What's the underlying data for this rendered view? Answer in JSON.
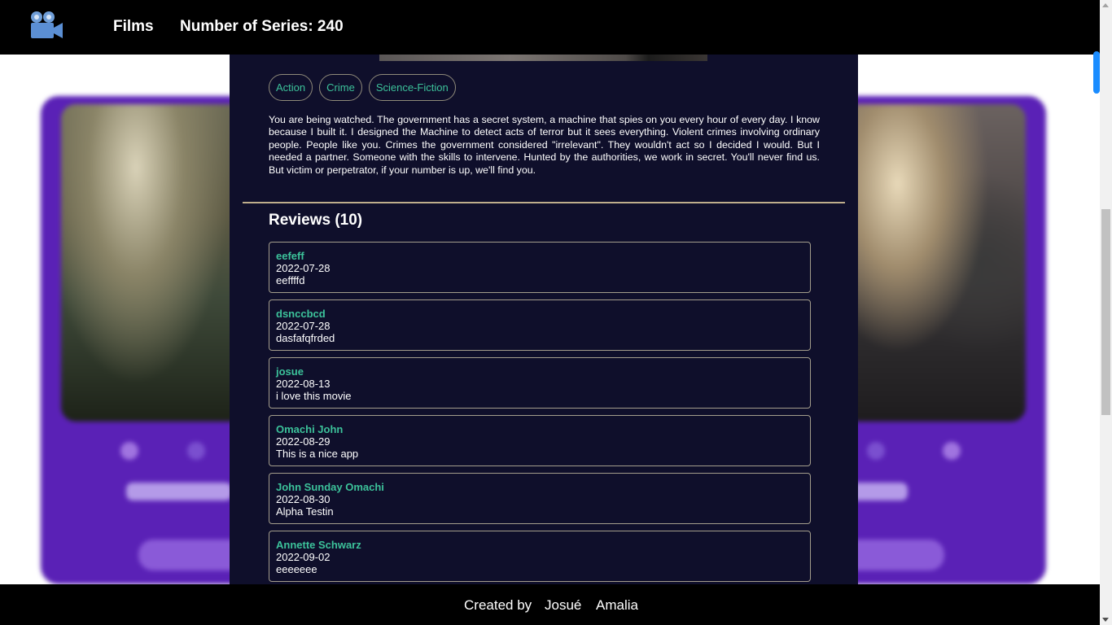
{
  "header": {
    "nav_films": "Films",
    "series_count": "Number of Series: 240",
    "logo_icon": "video-camera-icon"
  },
  "modal": {
    "genres": [
      "Action",
      "Crime",
      "Science-Fiction"
    ],
    "overview": "You are being watched. The government has a secret system, a machine that spies on you every hour of every day. I know because I built it. I designed the Machine to detect acts of terror but it sees everything. Violent crimes involving ordinary people. People like you. Crimes the government considered \"irrelevant\". They wouldn't act so I decided I would. But I needed a partner. Someone with the skills to intervene. Hunted by the authorities, we work in secret. You'll never find us. But victim or perpetrator, if your number is up, we'll find you.",
    "reviews_title": "Reviews (10)",
    "reviews": [
      {
        "author": "eefeff",
        "date": "2022-07-28",
        "text": "eeffffd"
      },
      {
        "author": "dsnccbcd",
        "date": "2022-07-28",
        "text": "dasfafqfrded"
      },
      {
        "author": "josue",
        "date": "2022-08-13",
        "text": "i love this movie"
      },
      {
        "author": "Omachi John",
        "date": "2022-08-29",
        "text": "This is a nice app"
      },
      {
        "author": "John Sunday Omachi",
        "date": "2022-08-30",
        "text": "Alpha Testin"
      },
      {
        "author": "Annette Schwarz",
        "date": "2022-09-02",
        "text": "eeeeeee"
      }
    ]
  },
  "footer": {
    "created_by": "Created by",
    "author1": "Josué",
    "author2": "Amalia"
  },
  "colors": {
    "accent_green": "#3cc29a",
    "modal_bg": "#0f0f2b",
    "card_purple": "#5a21b6",
    "bar_black": "#000000"
  }
}
